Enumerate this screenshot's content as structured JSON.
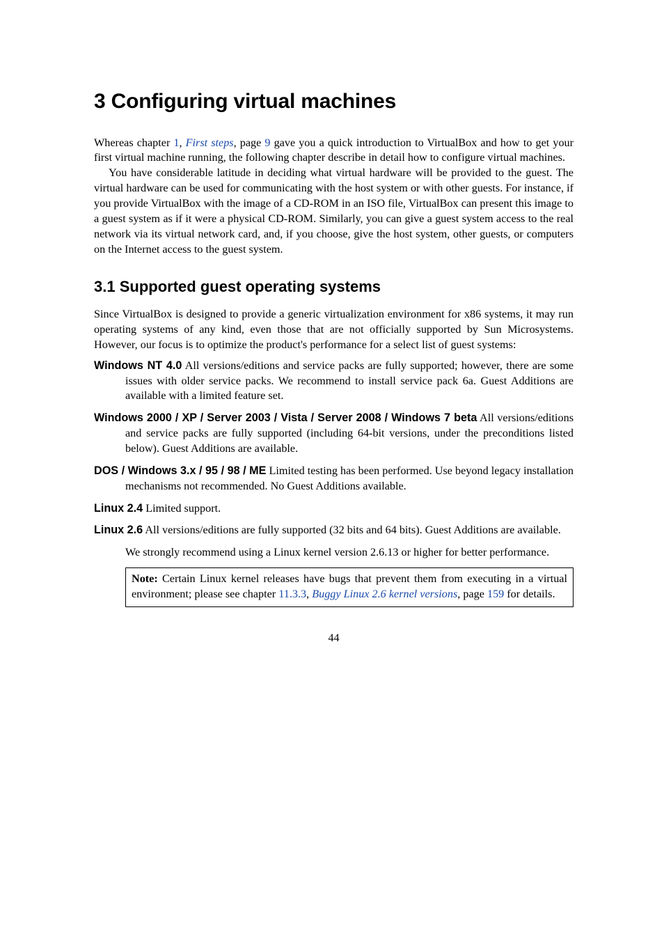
{
  "chapter": {
    "number": "3",
    "title": "Configuring virtual machines"
  },
  "intro": {
    "p1_a": "Whereas chapter ",
    "p1_chapnum": "1",
    "p1_b": ", ",
    "p1_chaptitle": "First steps",
    "p1_c": ", page ",
    "p1_pagenum": "9",
    "p1_d": " gave you a quick introduction to VirtualBox and how to get your first virtual machine running, the following chapter describe in detail how to configure virtual machines.",
    "p2": "You have considerable latitude in deciding what virtual hardware will be provided to the guest. The virtual hardware can be used for communicating with the host system or with other guests. For instance, if you provide VirtualBox with the image of a CD-ROM in an ISO file, VirtualBox can present this image to a guest system as if it were a physical CD-ROM. Similarly, you can give a guest system access to the real network via its virtual network card, and, if you choose, give the host system, other guests, or computers on the Internet access to the guest system."
  },
  "section": {
    "number": "3.1",
    "title": "Supported guest operating systems",
    "lead": "Since VirtualBox is designed to provide a generic virtualization environment for x86 systems, it may run operating systems of any kind, even those that are not officially supported by Sun Microsystems. However, our focus is to optimize the product's performance for a select list of guest systems:"
  },
  "items": {
    "nt40": {
      "term": "Windows NT 4.0",
      "desc": " All versions/editions and service packs are fully supported; however, there are some issues with older service packs. We recommend to install service pack 6a. Guest Additions are available with a limited feature set."
    },
    "win2k": {
      "term": "Windows 2000 / XP / Server 2003 / Vista / Server 2008 / Windows 7 beta",
      "desc": " All versions/editions and service packs are fully supported (including 64-bit versions, under the preconditions listed below). Guest Additions are available."
    },
    "dos": {
      "term": "DOS / Windows 3.x / 95 / 98 / ME",
      "desc": " Limited testing has been performed. Use beyond legacy installation mechanisms not recommended. No Guest Additions available."
    },
    "l24": {
      "term": "Linux 2.4",
      "desc": " Limited support."
    },
    "l26": {
      "term": "Linux 2.6",
      "desc": " All versions/editions are fully supported (32 bits and 64 bits). Guest Additions are available.",
      "sub": "We strongly recommend using a Linux kernel version 2.6.13 or higher for better performance."
    }
  },
  "note": {
    "label": "Note:",
    "a": " Certain Linux kernel releases have bugs that prevent them from executing in a virtual environment; please see chapter ",
    "chap": "11.3.3",
    "b": ", ",
    "title": "Buggy Linux 2.6 kernel versions",
    "c": ", page ",
    "page": "159",
    "d": " for details."
  },
  "pagenum": "44"
}
